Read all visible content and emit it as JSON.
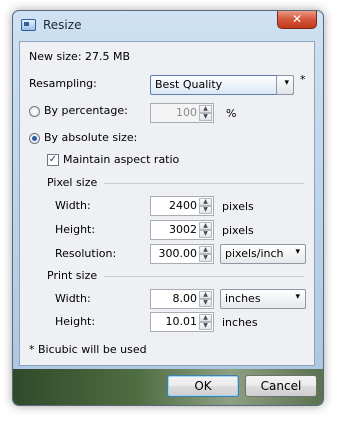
{
  "window": {
    "title": "Resize",
    "close_label": "✕"
  },
  "new_size": "New size: 27.5 MB",
  "resampling": {
    "label": "Resampling:",
    "selected": "Best Quality",
    "footnote_mark": "*"
  },
  "by_percentage": {
    "label": "By percentage:",
    "value": "100",
    "unit": "%",
    "checked": false
  },
  "by_absolute": {
    "label": "By absolute size:",
    "checked": true
  },
  "maintain_aspect": {
    "label": "Maintain aspect ratio",
    "checked": true,
    "check_glyph": "✓"
  },
  "pixel_size": {
    "heading": "Pixel size",
    "width": {
      "label": "Width:",
      "value": "2400",
      "unit": "pixels"
    },
    "height": {
      "label": "Height:",
      "value": "3002",
      "unit": "pixels"
    },
    "resolution": {
      "label": "Resolution:",
      "value": "300.00",
      "unit": "pixels/inch"
    }
  },
  "print_size": {
    "heading": "Print size",
    "width": {
      "label": "Width:",
      "value": "8.00",
      "unit": "inches"
    },
    "height": {
      "label": "Height:",
      "value": "10.01",
      "unit": "inches"
    }
  },
  "footnote": "* Bicubic will be used",
  "buttons": {
    "ok": "OK",
    "cancel": "Cancel"
  },
  "icons": {
    "dropdown": "▾",
    "spin_up": "▲",
    "spin_down": "▼"
  }
}
